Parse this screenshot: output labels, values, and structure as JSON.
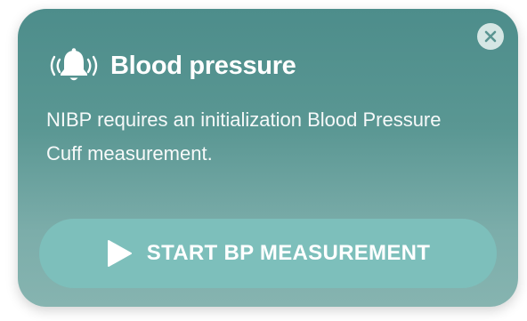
{
  "alert": {
    "icon": "bell-ringing-icon",
    "title": "Blood pressure",
    "message": "NIBP requires an initialization Blood Pressure Cuff measurement.",
    "close_icon": "close-icon",
    "action": {
      "icon": "play-icon",
      "label": "START BP MEASUREMENT"
    }
  },
  "colors": {
    "card_top": "#4d8d8b",
    "card_bottom": "#86b4b0",
    "button": "#7dbfbb",
    "text": "#ffffff",
    "close_bg": "#d5e6e4"
  }
}
